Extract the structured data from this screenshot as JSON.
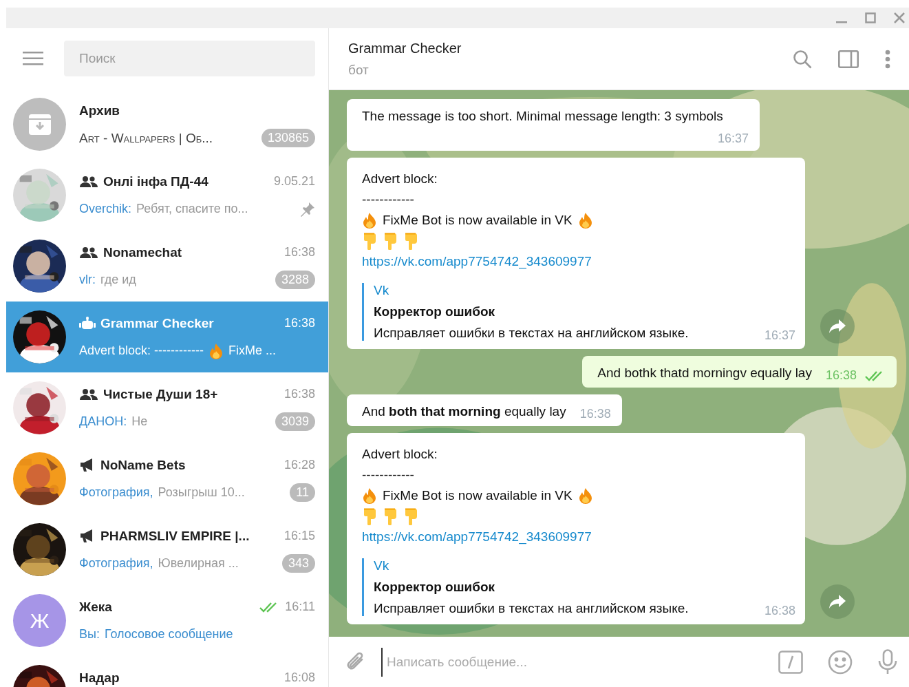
{
  "sidebar": {
    "search": {
      "placeholder": "Поиск"
    },
    "chats": [
      {
        "kind": "archive",
        "name": "Архив",
        "avatar": {
          "kind": "archive"
        },
        "preview": [
          {
            "kind": "smallcaps",
            "text": "Art - Wallpapers | Об..."
          }
        ],
        "badge": "130865",
        "selected": false
      },
      {
        "kind": "group",
        "name": "Онлі інфа ПД-44",
        "time": "9.05.21",
        "avatar": {
          "kind": "picture"
        },
        "preview": [
          {
            "kind": "sender",
            "text": "Overchik:"
          },
          {
            "kind": "text",
            "text": "Ребят, спасите по..."
          }
        ],
        "pinned": true,
        "selected": false
      },
      {
        "kind": "group",
        "name": "Nonamechat",
        "time": "16:38",
        "avatar": {
          "kind": "picture"
        },
        "preview": [
          {
            "kind": "sender",
            "text": "vlr:"
          },
          {
            "kind": "text",
            "text": "где ид"
          }
        ],
        "badge": "3288",
        "selected": false
      },
      {
        "kind": "bot",
        "name": "Grammar Checker",
        "time": "16:38",
        "avatar": {
          "kind": "picture"
        },
        "preview": [
          {
            "kind": "text",
            "text": "Advert block: ------------"
          },
          {
            "kind": "fire"
          },
          {
            "kind": "text",
            "text": "FixMe ..."
          }
        ],
        "selected": true
      },
      {
        "kind": "group",
        "name": "Чистые Души 18+",
        "time": "16:38",
        "avatar": {
          "kind": "picture"
        },
        "preview": [
          {
            "kind": "sender",
            "text": "ДАНОН:"
          },
          {
            "kind": "text",
            "text": "Не"
          }
        ],
        "badge": "3039",
        "selected": false
      },
      {
        "kind": "channel",
        "name": "NoName Bets",
        "time": "16:28",
        "avatar": {
          "kind": "picture"
        },
        "preview": [
          {
            "kind": "media",
            "text": "Фотография,"
          },
          {
            "kind": "text",
            "text": "Розыгрыш 10..."
          }
        ],
        "badge": "11",
        "selected": false
      },
      {
        "kind": "channel",
        "name": "PHARMSLIV EMPIRE |...",
        "time": "16:15",
        "avatar": {
          "kind": "picture"
        },
        "preview": [
          {
            "kind": "media",
            "text": "Фотография,"
          },
          {
            "kind": "text",
            "text": "Ювелирная ..."
          }
        ],
        "badge": "343",
        "selected": false
      },
      {
        "kind": "user",
        "name": "Жека",
        "time": "16:11",
        "read": true,
        "avatar": {
          "kind": "letter",
          "letter": "Ж",
          "color": "#a695e7"
        },
        "preview": [
          {
            "kind": "sender",
            "text": "Вы:"
          },
          {
            "kind": "media",
            "text": "Голосовое сообщение"
          }
        ],
        "selected": false
      },
      {
        "kind": "user",
        "name": "Надар",
        "time": "16:08",
        "avatar": {
          "kind": "picture"
        },
        "selected": false
      }
    ]
  },
  "chat": {
    "title": "Grammar Checker",
    "status": "бот",
    "messages": [
      {
        "kind": "text",
        "outgoing": false,
        "text": "The message is too short. Minimal message length: 3 symbols",
        "time": "16:37"
      },
      {
        "kind": "advert",
        "outgoing": false,
        "lines": [
          [
            {
              "kind": "text",
              "text": "Advert block:"
            }
          ],
          [
            {
              "kind": "text",
              "text": "------------"
            }
          ],
          [
            {
              "kind": "fire"
            },
            {
              "kind": "text",
              "text": "FixMe Bot is now available in VK"
            },
            {
              "kind": "fire"
            }
          ],
          [
            {
              "kind": "point"
            },
            {
              "kind": "point"
            },
            {
              "kind": "point"
            }
          ],
          [
            {
              "kind": "link",
              "text": "https://vk.com/app7754742_343609977"
            }
          ]
        ],
        "link_preview": {
          "site": "Vk",
          "title": "Корректор ошибок",
          "description": "Исправляет ошибки в текстах на английском языке."
        },
        "time": "16:37",
        "forward": true
      },
      {
        "kind": "text",
        "outgoing": true,
        "text": "And bothk thatd morningv equally lay",
        "time": "16:38",
        "read": true
      },
      {
        "kind": "text",
        "outgoing": false,
        "text": "And **both that morning** equally lay",
        "time": "16:38"
      },
      {
        "kind": "advert",
        "outgoing": false,
        "lines": [
          [
            {
              "kind": "text",
              "text": "Advert block:"
            }
          ],
          [
            {
              "kind": "text",
              "text": "------------"
            }
          ],
          [
            {
              "kind": "fire"
            },
            {
              "kind": "text",
              "text": "FixMe Bot is now available in VK"
            },
            {
              "kind": "fire"
            }
          ],
          [
            {
              "kind": "point"
            },
            {
              "kind": "point"
            },
            {
              "kind": "point"
            }
          ],
          [
            {
              "kind": "link",
              "text": "https://vk.com/app7754742_343609977"
            }
          ]
        ],
        "link_preview": {
          "site": "Vk",
          "title": "Корректор ошибок",
          "description": "Исправляет ошибки в текстах на английском языке."
        },
        "time": "16:38",
        "forward": true
      }
    ],
    "composer": {
      "placeholder": "Написать сообщение..."
    }
  }
}
